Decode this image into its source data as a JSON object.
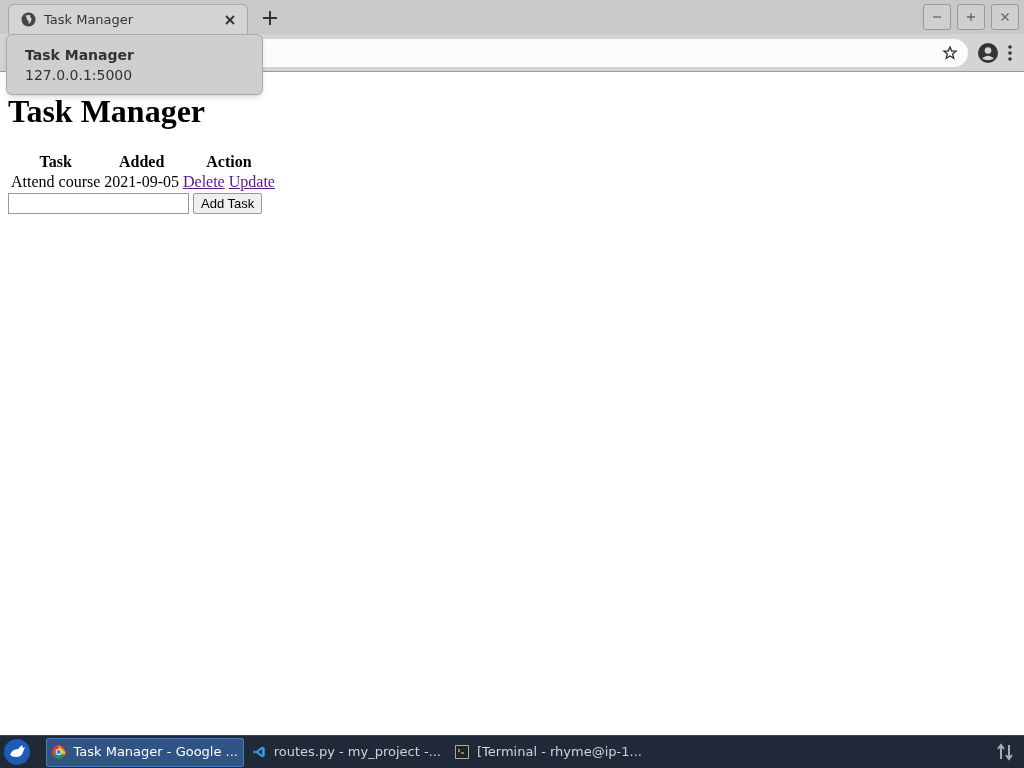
{
  "browser": {
    "tab": {
      "title": "Task Manager",
      "selected": true
    },
    "tooltip": {
      "title": "Task Manager",
      "url": "127.0.0.1:5000"
    }
  },
  "page": {
    "heading": "Task Manager",
    "table": {
      "columns": [
        "Task",
        "Added",
        "Action"
      ],
      "rows": [
        {
          "task": "Attend course",
          "added": "2021-09-05",
          "actions": [
            "Delete",
            "Update"
          ]
        }
      ]
    },
    "form": {
      "button": "Add Task"
    }
  },
  "taskbar": {
    "items": [
      {
        "kind": "browser",
        "label": "Task Manager - Google ...",
        "selected": true
      },
      {
        "kind": "editor",
        "label": "routes.py - my_project -...",
        "selected": false
      },
      {
        "kind": "terminal",
        "label": "[Terminal - rhyme@ip-1...",
        "selected": false
      }
    ]
  }
}
